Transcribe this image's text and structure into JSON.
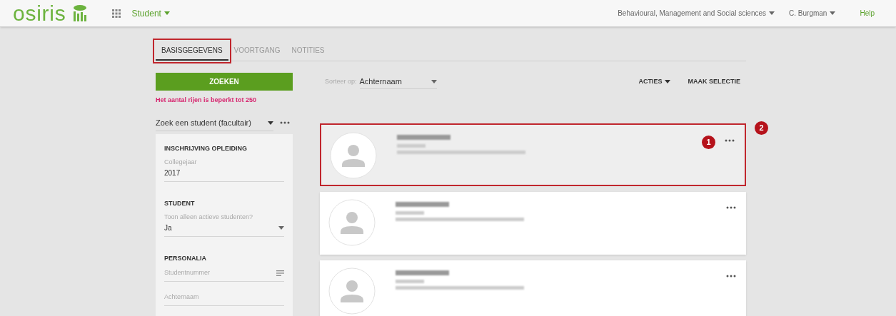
{
  "header": {
    "logo": "osiris",
    "module": "Student",
    "faculty": "Behavioural, Management and Social sciences",
    "user": "C. Burgman",
    "help": "Help"
  },
  "tabs": [
    {
      "label": "BASISGEGEVENS",
      "selected": true,
      "highlighted": true
    },
    {
      "label": "VOORTGANG",
      "selected": false,
      "highlighted": false
    },
    {
      "label": "NOTITIES",
      "selected": false,
      "highlighted": false
    }
  ],
  "search_button": "ZOEKEN",
  "limit_message": "Het aantal rijen is beperkt tot 250",
  "search_profile": "Zoek een student (facultair)",
  "filter_sections": [
    {
      "title": "INSCHRIJVING OPLEIDING",
      "fields": [
        {
          "kind": "text",
          "label": "Collegejaar",
          "value": "2017"
        }
      ]
    },
    {
      "title": "STUDENT",
      "fields": [
        {
          "kind": "select",
          "label": "Toon alleen actieve studenten?",
          "value": "Ja"
        }
      ]
    },
    {
      "title": "PERSONALIA",
      "fields": [
        {
          "kind": "list",
          "placeholder": "Studentnummer"
        },
        {
          "kind": "text",
          "placeholder": "Achternaam"
        }
      ]
    }
  ],
  "sort": {
    "label": "Sorteer op:",
    "value": "Achternaam"
  },
  "actions": [
    "ACTIES",
    "MAAK SELECTIE"
  ],
  "results": [
    {
      "highlighted": true
    },
    {
      "highlighted": false
    },
    {
      "highlighted": false
    }
  ],
  "markers": [
    {
      "label": "1"
    },
    {
      "label": "2"
    }
  ]
}
